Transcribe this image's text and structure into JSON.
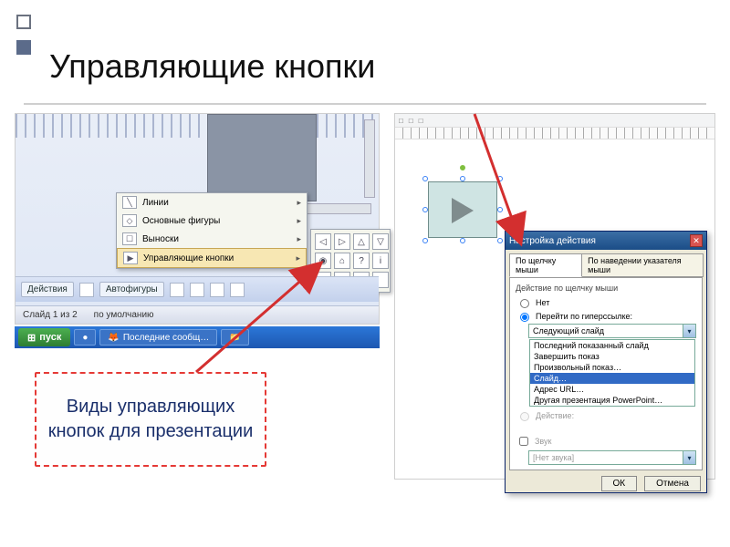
{
  "slide": {
    "title": "Управляющие кнопки"
  },
  "callout": {
    "text": "Виды управляющих кнопок для презентации"
  },
  "menu": {
    "items": [
      {
        "label": "Линии"
      },
      {
        "label": "Основные фигуры"
      },
      {
        "label": "Выноски"
      },
      {
        "label": "Управляющие кнопки"
      }
    ]
  },
  "button_grid_glyphs": [
    "◁",
    "▷",
    "△",
    "▽",
    "◉",
    "⌂",
    "?",
    "i",
    "◀",
    "▶",
    "▣",
    ""
  ],
  "toolbar": {
    "actions_label": "Действия",
    "autoshapes_label": "Автофигуры"
  },
  "statusbar": {
    "slide_label": "Слайд 1 из 2",
    "default_label": "по умолчанию"
  },
  "taskbar": {
    "start_label": "пуск",
    "tasks": [
      "",
      "Последние сообщ…",
      ""
    ]
  },
  "dialog": {
    "title": "Настройка действия",
    "tabs": [
      "По щелчку мыши",
      "По наведении указателя мыши"
    ],
    "group_label": "Действие по щелчку мыши",
    "radio_none": "Нет",
    "radio_hyperlink": "Перейти по гиперссылке:",
    "dropdown_selected": "Следующий слайд",
    "options": [
      "Последний показанный слайд",
      "Завершить показ",
      "Произвольный показ…",
      "Слайд…",
      "Адрес URL…",
      "Другая презентация PowerPoint…"
    ],
    "selected_option_index": 3,
    "radio_run": "Действие:",
    "check_sound": "Звук",
    "sound_placeholder": "[Нет звука]",
    "ok": "ОК",
    "cancel": "Отмена"
  }
}
